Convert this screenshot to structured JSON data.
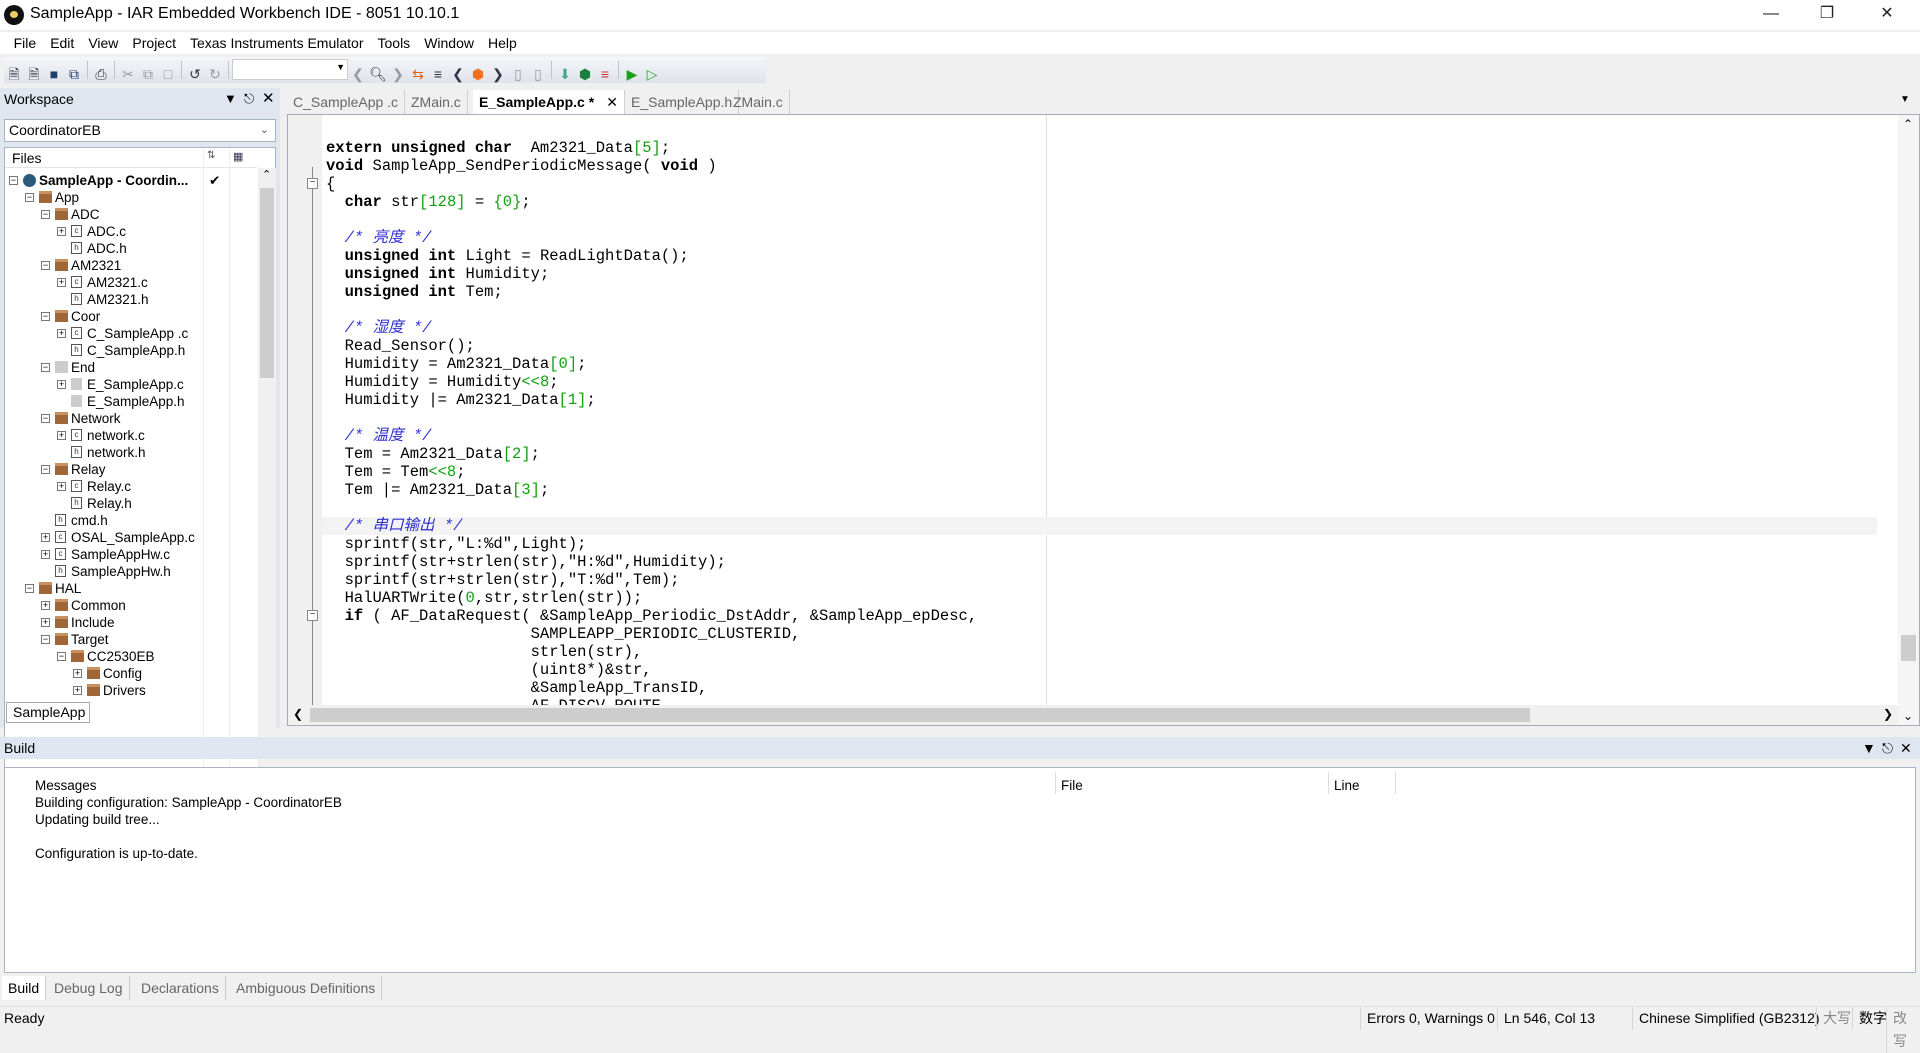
{
  "window": {
    "title": "SampleApp - IAR Embedded Workbench IDE - 8051 10.10.1"
  },
  "menu": [
    "File",
    "Edit",
    "View",
    "Project",
    "Texas Instruments Emulator",
    "Tools",
    "Window",
    "Help"
  ],
  "toolbar": {
    "icons": [
      "new-file",
      "new-file",
      "save",
      "save-all",
      "print",
      "cut",
      "copy",
      "paste",
      "undo",
      "redo",
      "combo",
      "back",
      "find",
      "forward",
      "toggle-bookmark",
      "step-list",
      "prev",
      "breakpoint",
      "next",
      "prev-doc",
      "next-doc",
      "download",
      "download-debug",
      "options",
      "go",
      "run"
    ]
  },
  "workspace": {
    "title": "Workspace",
    "config": "CoordinatorEB",
    "files_header": "Files",
    "bottom_tab": "SampleApp",
    "tree": [
      {
        "l": 0,
        "t": "proj",
        "e": "-",
        "n": "SampleApp - Coordin...",
        "check": "✔"
      },
      {
        "l": 1,
        "t": "folder",
        "e": "-",
        "n": "App"
      },
      {
        "l": 2,
        "t": "folder",
        "e": "-",
        "n": "ADC"
      },
      {
        "l": 3,
        "t": "c",
        "e": "+",
        "n": "ADC.c"
      },
      {
        "l": 3,
        "t": "h",
        "e": "",
        "n": "ADC.h"
      },
      {
        "l": 2,
        "t": "folder",
        "e": "-",
        "n": "AM2321"
      },
      {
        "l": 3,
        "t": "c",
        "e": "+",
        "n": "AM2321.c"
      },
      {
        "l": 3,
        "t": "h",
        "e": "",
        "n": "AM2321.h"
      },
      {
        "l": 2,
        "t": "folder",
        "e": "-",
        "n": "Coor"
      },
      {
        "l": 3,
        "t": "c",
        "e": "+",
        "n": "C_SampleApp .c"
      },
      {
        "l": 3,
        "t": "h",
        "e": "",
        "n": "C_SampleApp.h"
      },
      {
        "l": 2,
        "t": "gfolder",
        "e": "-",
        "n": "End"
      },
      {
        "l": 3,
        "t": "gfile",
        "e": "+",
        "n": "E_SampleApp.c"
      },
      {
        "l": 3,
        "t": "gfile",
        "e": "",
        "n": "E_SampleApp.h"
      },
      {
        "l": 2,
        "t": "folder",
        "e": "-",
        "n": "Network"
      },
      {
        "l": 3,
        "t": "c",
        "e": "+",
        "n": "network.c"
      },
      {
        "l": 3,
        "t": "h",
        "e": "",
        "n": "network.h"
      },
      {
        "l": 2,
        "t": "folder",
        "e": "-",
        "n": "Relay"
      },
      {
        "l": 3,
        "t": "c",
        "e": "+",
        "n": "Relay.c"
      },
      {
        "l": 3,
        "t": "h",
        "e": "",
        "n": "Relay.h"
      },
      {
        "l": 2,
        "t": "h",
        "e": "",
        "n": "cmd.h"
      },
      {
        "l": 2,
        "t": "c",
        "e": "+",
        "n": "OSAL_SampleApp.c"
      },
      {
        "l": 2,
        "t": "c",
        "e": "+",
        "n": "SampleAppHw.c"
      },
      {
        "l": 2,
        "t": "h",
        "e": "",
        "n": "SampleAppHw.h"
      },
      {
        "l": 1,
        "t": "folder",
        "e": "-",
        "n": "HAL"
      },
      {
        "l": 2,
        "t": "folder",
        "e": "+",
        "n": "Common"
      },
      {
        "l": 2,
        "t": "folder",
        "e": "+",
        "n": "Include"
      },
      {
        "l": 2,
        "t": "folder",
        "e": "-",
        "n": "Target"
      },
      {
        "l": 3,
        "t": "folder",
        "e": "-",
        "n": "CC2530EB"
      },
      {
        "l": 4,
        "t": "folder",
        "e": "+",
        "n": "Config"
      },
      {
        "l": 4,
        "t": "folder",
        "e": "+",
        "n": "Drivers"
      }
    ]
  },
  "editor": {
    "tabs": [
      "C_SampleApp .c",
      "ZMain.c",
      "E_SampleApp.c *",
      "E_SampleApp.h",
      "ZMain.c"
    ],
    "active_tab": 2,
    "current_line": 21,
    "lines": [
      [
        [
          "kw",
          "extern unsigned char"
        ],
        [
          "",
          "  Am2321_Data"
        ],
        [
          "num",
          "[5]"
        ],
        [
          "",
          ";"
        ]
      ],
      [
        [
          "kw",
          "void"
        ],
        [
          "",
          " SampleApp_SendPeriodicMessage( "
        ],
        [
          "kw",
          "void"
        ],
        [
          "",
          " )"
        ]
      ],
      [
        [
          "",
          "{"
        ]
      ],
      [
        [
          "",
          "  "
        ],
        [
          "kw",
          "char"
        ],
        [
          "",
          " str"
        ],
        [
          "num",
          "[128]"
        ],
        [
          "",
          " = "
        ],
        [
          "num",
          "{0}"
        ],
        [
          "",
          ";"
        ]
      ],
      [],
      [
        [
          "",
          "  "
        ],
        [
          "cm",
          "/* 亮度 */"
        ]
      ],
      [
        [
          "",
          "  "
        ],
        [
          "kw",
          "unsigned int"
        ],
        [
          "",
          " Light = ReadLightData();"
        ]
      ],
      [
        [
          "",
          "  "
        ],
        [
          "kw",
          "unsigned int"
        ],
        [
          "",
          " Humidity;"
        ]
      ],
      [
        [
          "",
          "  "
        ],
        [
          "kw",
          "unsigned int"
        ],
        [
          "",
          " Tem;"
        ]
      ],
      [],
      [
        [
          "",
          "  "
        ],
        [
          "cm",
          "/* 湿度 */"
        ]
      ],
      [
        [
          "",
          "  Read_Sensor();"
        ]
      ],
      [
        [
          "",
          "  Humidity = Am2321_Data"
        ],
        [
          "num",
          "[0]"
        ],
        [
          "",
          ";"
        ]
      ],
      [
        [
          "",
          "  Humidity = Humidity"
        ],
        [
          "num",
          "<<8"
        ],
        [
          "",
          ";"
        ]
      ],
      [
        [
          "",
          "  Humidity |= Am2321_Data"
        ],
        [
          "num",
          "[1]"
        ],
        [
          "",
          ";"
        ]
      ],
      [],
      [
        [
          "",
          "  "
        ],
        [
          "cm",
          "/* 温度 */"
        ]
      ],
      [
        [
          "",
          "  Tem = Am2321_Data"
        ],
        [
          "num",
          "[2]"
        ],
        [
          "",
          ";"
        ]
      ],
      [
        [
          "",
          "  Tem = Tem"
        ],
        [
          "num",
          "<<8"
        ],
        [
          "",
          ";"
        ]
      ],
      [
        [
          "",
          "  Tem |= Am2321_Data"
        ],
        [
          "num",
          "[3]"
        ],
        [
          "",
          ";"
        ]
      ],
      [],
      [
        [
          "",
          "  "
        ],
        [
          "cm",
          "/* 串口输出 */"
        ]
      ],
      [
        [
          "",
          "  sprintf(str,\"L:%d\",Light);"
        ]
      ],
      [
        [
          "",
          "  sprintf(str+strlen(str),\"H:%d\",Humidity);"
        ]
      ],
      [
        [
          "",
          "  sprintf(str+strlen(str),\"T:%d\",Tem);"
        ]
      ],
      [
        [
          "",
          "  HalUARTWrite("
        ],
        [
          "num",
          "0"
        ],
        [
          "",
          ",str,strlen(str));"
        ]
      ],
      [
        [
          "",
          "  "
        ],
        [
          "kw",
          "if"
        ],
        [
          "",
          " ( AF_DataRequest( &SampleApp_Periodic_DstAddr, &SampleApp_epDesc,"
        ]
      ],
      [
        [
          "",
          "                      SAMPLEAPP_PERIODIC_CLUSTERID,"
        ]
      ],
      [
        [
          "",
          "                      strlen(str),"
        ]
      ],
      [
        [
          "",
          "                      (uint8*)&str,"
        ]
      ],
      [
        [
          "",
          "                      &SampleApp_TransID,"
        ]
      ],
      [
        [
          "",
          "                      AF_DISCV_ROUTE,"
        ]
      ]
    ],
    "fold_lines": [
      2,
      26
    ]
  },
  "build": {
    "title": "Build",
    "columns": [
      "Messages",
      "File",
      "Line"
    ],
    "messages": [
      "Building configuration: SampleApp - CoordinatorEB",
      "Updating build tree...",
      "",
      "Configuration is up-to-date."
    ],
    "tabs": [
      "Build",
      "Debug Log",
      "Declarations",
      "Ambiguous Definitions"
    ]
  },
  "status": {
    "ready": "Ready",
    "errors": "Errors 0, Warnings 0",
    "position": "Ln 546, Col 13",
    "encoding": "Chinese Simplified (GB2312)",
    "caps": "大写",
    "num": "数字",
    "ovr": "改写"
  }
}
